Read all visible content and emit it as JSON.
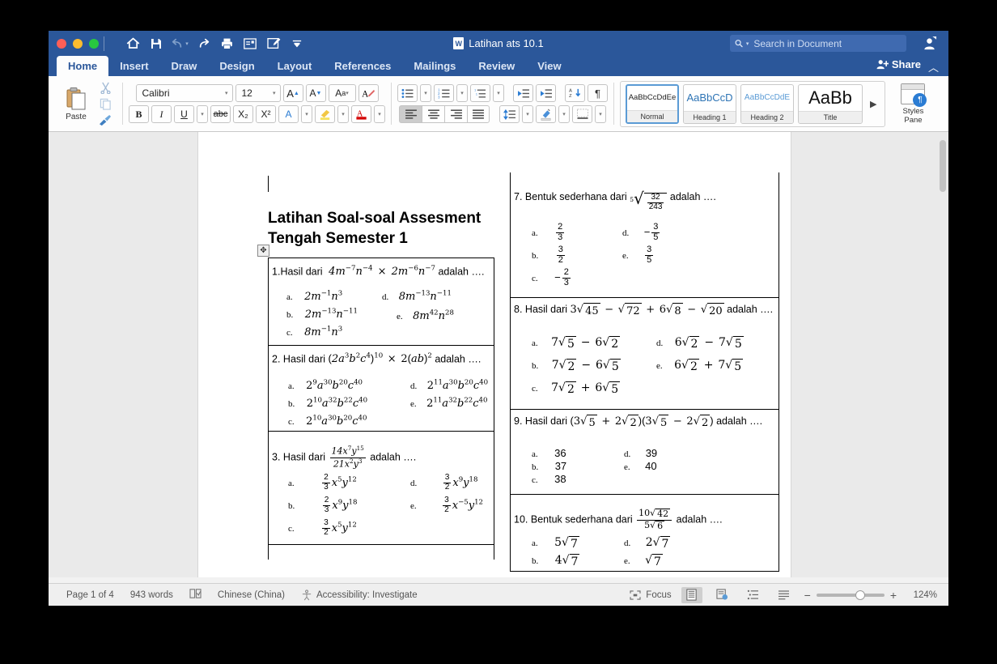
{
  "window": {
    "title": "Latihan ats 10.1",
    "traffic_lights": [
      "close",
      "minimize",
      "maximize"
    ],
    "quick_access": [
      "home-icon",
      "save-icon",
      "undo-icon",
      "redo-icon",
      "print-icon",
      "print-preview-icon",
      "edit-icon",
      "qat-more-icon"
    ],
    "search": {
      "placeholder": "Search in Document",
      "value": ""
    },
    "account_icon": "account-icon"
  },
  "tabs": [
    {
      "label": "Home",
      "active": true
    },
    {
      "label": "Insert",
      "active": false
    },
    {
      "label": "Draw",
      "active": false
    },
    {
      "label": "Design",
      "active": false
    },
    {
      "label": "Layout",
      "active": false
    },
    {
      "label": "References",
      "active": false
    },
    {
      "label": "Mailings",
      "active": false
    },
    {
      "label": "Review",
      "active": false
    },
    {
      "label": "View",
      "active": false
    }
  ],
  "share": {
    "label": "Share",
    "collapse_icon": "chevron-up-icon"
  },
  "ribbon": {
    "paste": {
      "label": "Paste",
      "cut": "cut-icon",
      "copy": "copy-icon",
      "format_painter": "format-painter-icon"
    },
    "font": {
      "family": "Calibri",
      "size": "12",
      "grow": "A▲",
      "shrink": "A▼",
      "change_case": "Aa",
      "clear_formatting": "clear-formatting-icon",
      "bold": "B",
      "italic": "I",
      "underline": "U",
      "strikethrough": "abc",
      "subscript": "X₂",
      "superscript": "X²",
      "text_effects": "A",
      "highlight": "highlight-icon",
      "font_color": "A"
    },
    "paragraph": {
      "bullets": "bullet-list-icon",
      "numbering": "numbered-list-icon",
      "multilevel": "multilevel-list-icon",
      "decrease_indent": "decrease-indent-icon",
      "increase_indent": "increase-indent-icon",
      "sort": "sort-icon",
      "show_marks": "¶",
      "align_left": "align-left-icon",
      "align_center": "align-center-icon",
      "align_right": "align-right-icon",
      "justify": "justify-icon",
      "line_spacing": "line-spacing-icon",
      "shading": "shading-icon",
      "borders": "borders-icon"
    },
    "styles": [
      {
        "preview": "AaBbCcDdEe",
        "name": "Normal",
        "selected": true
      },
      {
        "preview": "AaBbCcD",
        "name": "Heading 1",
        "selected": false
      },
      {
        "preview": "AaBbCcDdE",
        "name": "Heading 2",
        "selected": false
      },
      {
        "preview": "AaBb",
        "name": "Title",
        "selected": false
      }
    ],
    "styles_more": "▶",
    "styles_pane": {
      "line1": "Styles",
      "line2": "Pane",
      "badge": "¶"
    }
  },
  "document": {
    "heading_line1": "Latihan Soal-soal Assesment",
    "heading_line2": "Tengah Semester 1",
    "table_move_handle": "table-move-handle-icon",
    "questions_left": [
      {
        "number": "1.",
        "stem_prefix": "Hasil dari",
        "stem_math": "4m⁻⁷n⁻⁴ × 2m⁻⁶n⁻⁷",
        "stem_suffix": "adalah ….",
        "options": [
          {
            "letter": "a.",
            "text": "2m⁻¹n³"
          },
          {
            "letter": "b.",
            "text": "2m⁻¹³n⁻¹¹"
          },
          {
            "letter": "c.",
            "text": "8m⁻¹n³"
          },
          {
            "letter": "d.",
            "text": "8m⁻¹³n⁻¹¹"
          },
          {
            "letter": "e.",
            "text": "8m⁴²n²⁸"
          }
        ]
      },
      {
        "number": "2.",
        "stem_prefix": "Hasil dari",
        "stem_math": "(2a³b²c⁴)¹⁰ × 2(ab)²",
        "stem_suffix": "adalah ….",
        "options": [
          {
            "letter": "a.",
            "text": "2⁹a³⁰b²⁰c⁴⁰"
          },
          {
            "letter": "b.",
            "text": "2¹⁰a³²b²²c⁴⁰"
          },
          {
            "letter": "c.",
            "text": "2¹⁰a³⁰b²⁰c⁴⁰"
          },
          {
            "letter": "d.",
            "text": "2¹¹a³⁰b²⁰c⁴⁰"
          },
          {
            "letter": "e.",
            "text": "2¹¹a³²b²²c⁴⁰"
          }
        ]
      },
      {
        "number": "3.",
        "stem_prefix": "Hasil dari",
        "stem_math": "14x⁷y¹⁵ / 21x²y³",
        "stem_suffix": "adalah ….",
        "options": [
          {
            "letter": "a.",
            "text": "2/3 x⁵y¹²"
          },
          {
            "letter": "b.",
            "text": "2/3 x⁹y¹⁸"
          },
          {
            "letter": "c.",
            "text": "3/2 x⁵y¹²"
          },
          {
            "letter": "d.",
            "text": "3/2 x⁹y¹⁸"
          },
          {
            "letter": "e.",
            "text": "3/2 x⁻⁵y¹²"
          }
        ]
      }
    ],
    "questions_right": [
      {
        "number": "7.",
        "stem_prefix": "Bentuk sederhana dari",
        "stem_math": "⁵√(32/243)",
        "stem_suffix": "adalah ….",
        "options": [
          {
            "letter": "a.",
            "text": "2/3"
          },
          {
            "letter": "b.",
            "text": "3/2"
          },
          {
            "letter": "c.",
            "text": "− 2/3"
          },
          {
            "letter": "d.",
            "text": "− 3/5"
          },
          {
            "letter": "e.",
            "text": "3/5"
          }
        ]
      },
      {
        "number": "8.",
        "stem_prefix": "Hasil dari",
        "stem_math": "3√45 − √72 + 6√8 − √20",
        "stem_suffix": "adalah ….",
        "options": [
          {
            "letter": "a.",
            "text": "7√5 − 6√2"
          },
          {
            "letter": "b.",
            "text": "7√2 − 6√5"
          },
          {
            "letter": "c.",
            "text": "7√2 + 6√5"
          },
          {
            "letter": "d.",
            "text": "6√2 − 7√5"
          },
          {
            "letter": "e.",
            "text": "6√2 + 7√5"
          }
        ]
      },
      {
        "number": "9.",
        "stem_prefix": "Hasil dari",
        "stem_math": "(3√5 + 2√2)(3√5 − 2√2)",
        "stem_suffix": "adalah ….",
        "options": [
          {
            "letter": "a.",
            "text": "36"
          },
          {
            "letter": "b.",
            "text": "37"
          },
          {
            "letter": "c.",
            "text": "38"
          },
          {
            "letter": "d.",
            "text": "39"
          },
          {
            "letter": "e.",
            "text": "40"
          }
        ]
      },
      {
        "number": "10.",
        "stem_prefix": "Bentuk sederhana dari",
        "stem_math": "10√42 / 5√6",
        "stem_suffix": "adalah ….",
        "options": [
          {
            "letter": "a.",
            "text": "5√7"
          },
          {
            "letter": "b.",
            "text": "4√7"
          },
          {
            "letter": "d.",
            "text": "2√7"
          },
          {
            "letter": "e.",
            "text": "√7"
          }
        ]
      }
    ]
  },
  "statusbar": {
    "page": "Page 1 of 4",
    "words": "943 words",
    "proofing_icon": "proofing-icon",
    "language": "Chinese (China)",
    "accessibility_icon": "accessibility-icon",
    "accessibility": "Accessibility: Investigate",
    "focus_icon": "focus-icon",
    "focus": "Focus",
    "view_print": "print-layout-icon",
    "view_web": "web-layout-icon",
    "view_outline": "outline-view-icon",
    "view_draft": "draft-view-icon",
    "zoom_out": "−",
    "zoom_in": "+",
    "zoom": "124%"
  }
}
